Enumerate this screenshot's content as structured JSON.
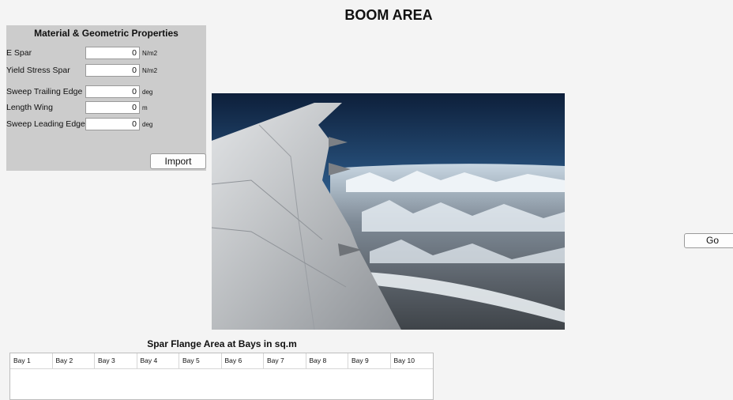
{
  "page": {
    "title": "BOOM AREA"
  },
  "material_panel": {
    "title": "Material & Geometric Properties",
    "fields": [
      {
        "label": "E Spar",
        "value": "0",
        "unit": "N/m2"
      },
      {
        "label": "Yield Stress Spar",
        "value": "0",
        "unit": "N/m2"
      },
      {
        "label": "Sweep Trailing Edge",
        "value": "0",
        "unit": "deg"
      },
      {
        "label": "Length Wing",
        "value": "0",
        "unit": "m"
      },
      {
        "label": "Sweep Leading Edge",
        "value": "0",
        "unit": "deg"
      }
    ],
    "import_label": "Import"
  },
  "go_label": "Go",
  "results": {
    "title": "Spar Flange Area at Bays in sq.m",
    "columns": [
      "Bay 1",
      "Bay 2",
      "Bay 3",
      "Bay 4",
      "Bay 5",
      "Bay 6",
      "Bay 7",
      "Bay 8",
      "Bay 9",
      "Bay 10"
    ]
  }
}
